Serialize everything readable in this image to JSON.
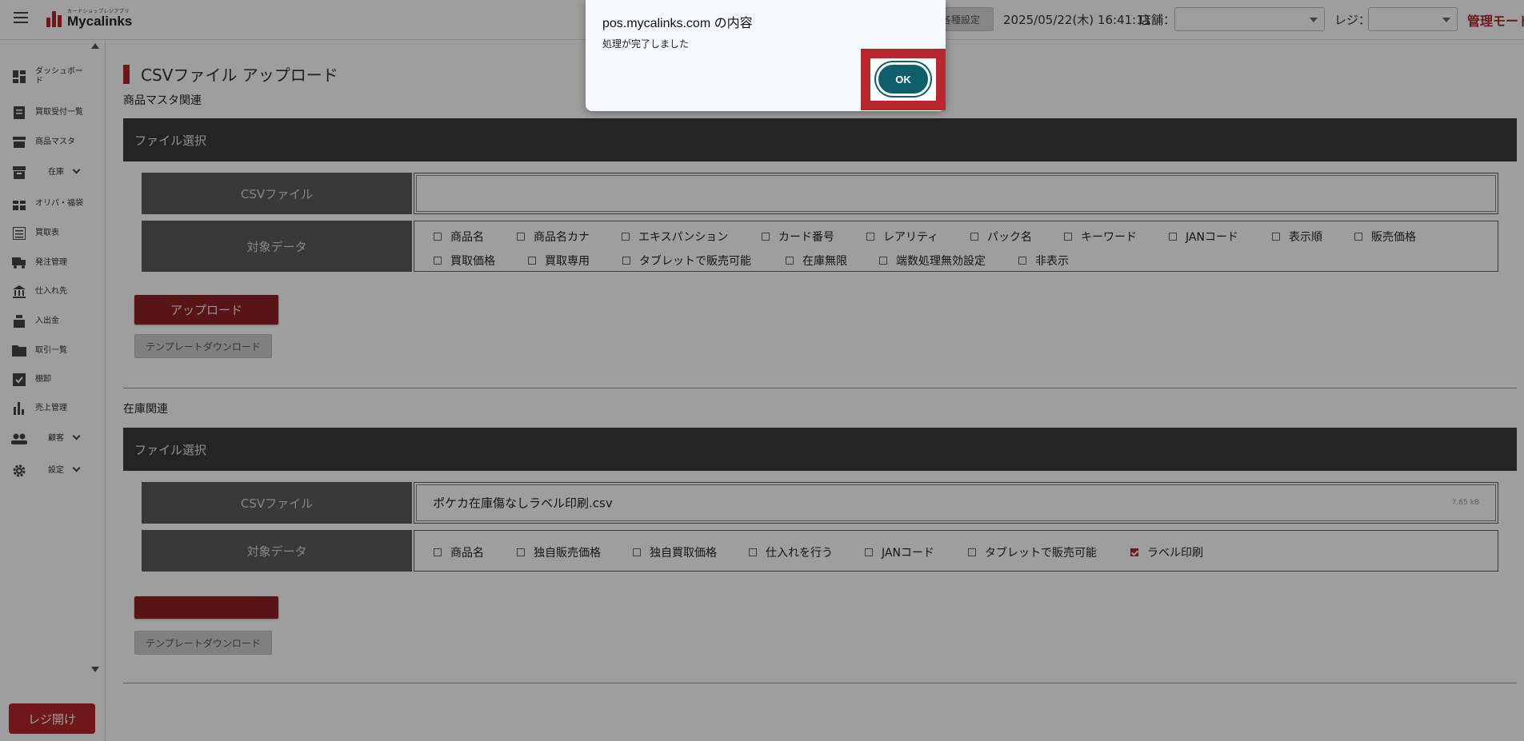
{
  "header": {
    "logo_sub": "カードショップレジアプリ",
    "logo_text": "Mycalinks",
    "settings_button": "各種設定",
    "datetime": "2025/05/22(木) 16:41:11",
    "store_label": "店舗：",
    "register_label": "レジ：",
    "mode_label": "管理モード"
  },
  "sidebar": {
    "items": [
      {
        "label": "ダッシュボード"
      },
      {
        "label": "買取受付一覧"
      },
      {
        "label": "商品マスタ"
      },
      {
        "label": "在庫"
      },
      {
        "label": "オリパ・福袋"
      },
      {
        "label": "買取表"
      },
      {
        "label": "発注管理"
      },
      {
        "label": "仕入れ先"
      },
      {
        "label": "入出金"
      },
      {
        "label": "取引一覧"
      },
      {
        "label": "棚卸"
      },
      {
        "label": "売上管理"
      },
      {
        "label": "顧客"
      },
      {
        "label": "設定"
      }
    ],
    "register_open_button": "レジ開け"
  },
  "main": {
    "page_title": "CSVファイル アップロード",
    "product_section": {
      "section_label": "商品マスタ関連",
      "panel_title": "ファイル選択",
      "csv_label": "CSVファイル",
      "target_label": "対象データ",
      "checkboxes_row1": [
        "商品名",
        "商品名カナ",
        "エキスパンション",
        "カード番号",
        "レアリティ",
        "パック名",
        "キーワード",
        "JANコード",
        "表示順",
        "販売価格"
      ],
      "checkboxes_row2": [
        "買取価格",
        "買取専用",
        "タブレットで販売可能",
        "在庫無限",
        "端数処理無効設定",
        "非表示"
      ],
      "upload_button": "アップロード",
      "template_button": "テンプレートダウンロード"
    },
    "stock_section": {
      "section_label": "在庫関連",
      "panel_title": "ファイル選択",
      "csv_label": "CSVファイル",
      "file_name": "ポケカ在庫傷なしラベル印刷.csv",
      "file_size": "7.65 kB",
      "target_label": "対象データ",
      "checkboxes": [
        "商品名",
        "独自販売価格",
        "独自買取価格",
        "仕入れを行う",
        "JANコード",
        "タブレットで販売可能",
        "ラベル印刷"
      ],
      "checked": "ラベル印刷",
      "template_button": "テンプレートダウンロード"
    }
  },
  "dialog": {
    "title": "pos.mycalinks.com の内容",
    "message": "処理が完了しました",
    "ok_button": "OK"
  },
  "colors": {
    "brand_red": "#b3262c",
    "panel_dark": "#3a3a3a",
    "ok_teal": "#0e5f69",
    "highlight_red": "#b8262e"
  }
}
